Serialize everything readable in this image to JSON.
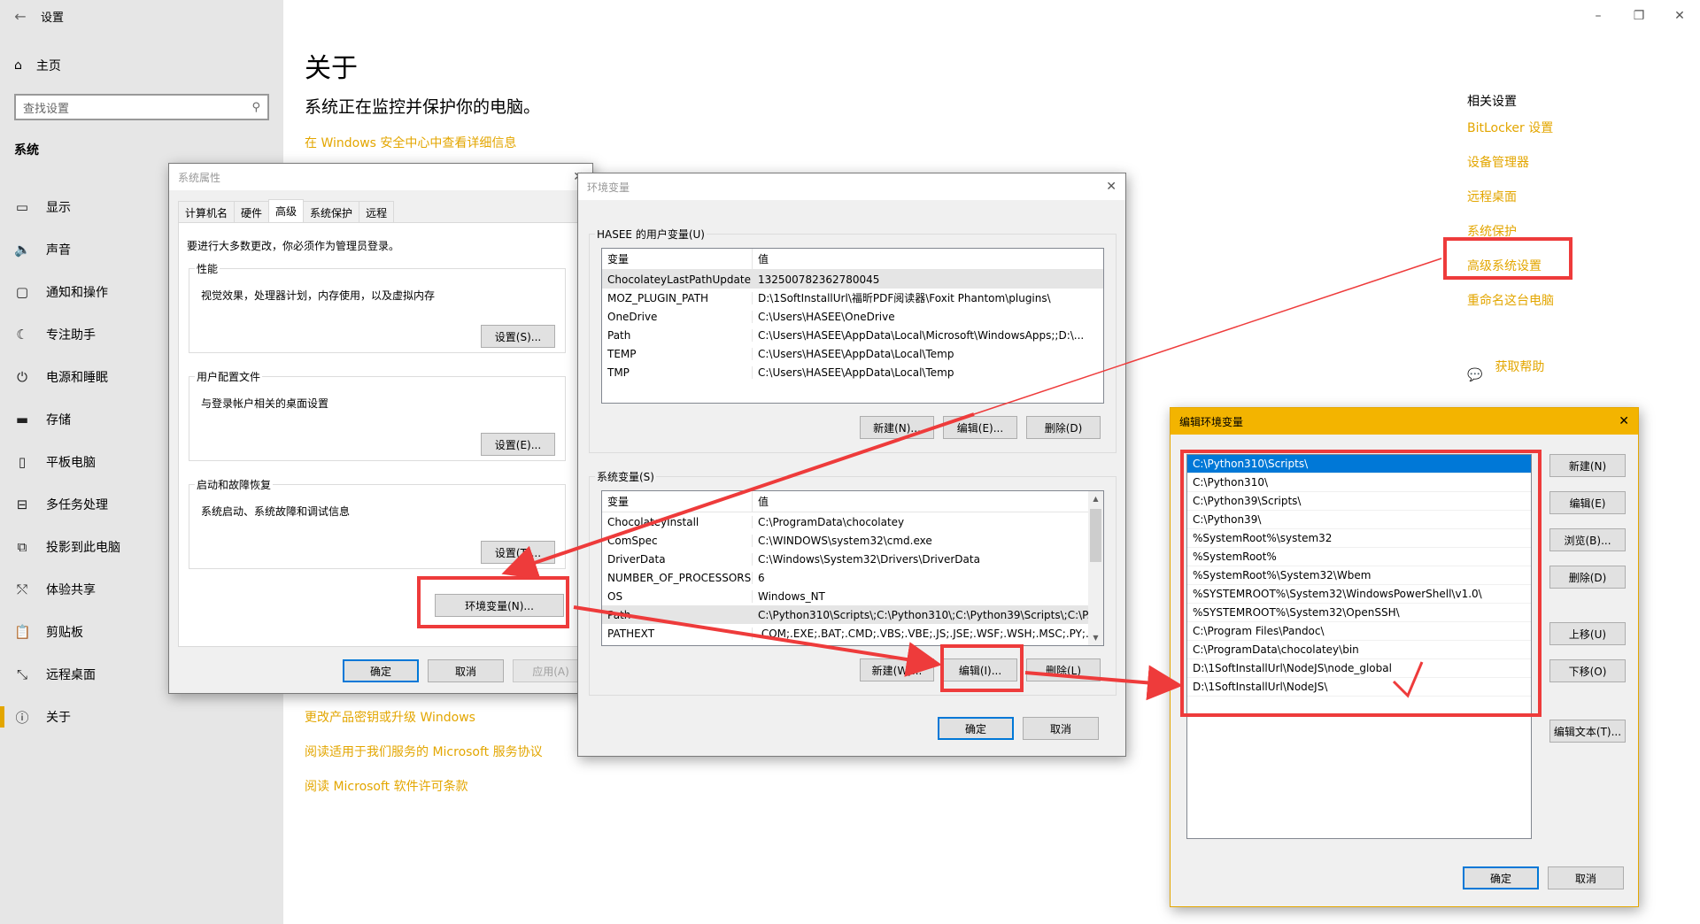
{
  "settings": {
    "window_title": "设置",
    "home_label": "主页",
    "search_placeholder": "查找设置",
    "section_label": "系统",
    "nav": [
      {
        "label": "显示",
        "icon": "monitor-icon"
      },
      {
        "label": "声音",
        "icon": "speaker-icon"
      },
      {
        "label": "通知和操作",
        "icon": "notification-icon"
      },
      {
        "label": "专注助手",
        "icon": "moon-icon"
      },
      {
        "label": "电源和睡眠",
        "icon": "power-icon"
      },
      {
        "label": "存储",
        "icon": "storage-icon"
      },
      {
        "label": "平板电脑",
        "icon": "tablet-icon"
      },
      {
        "label": "多任务处理",
        "icon": "multitask-icon"
      },
      {
        "label": "投影到此电脑",
        "icon": "project-icon"
      },
      {
        "label": "体验共享",
        "icon": "share-icon"
      },
      {
        "label": "剪贴板",
        "icon": "clipboard-icon"
      },
      {
        "label": "远程桌面",
        "icon": "remote-icon"
      },
      {
        "label": "关于",
        "icon": "info-icon",
        "active": true
      }
    ],
    "accent_color": "#e3a600"
  },
  "main": {
    "title": "关于",
    "status": "系统正在监控并保护你的电脑。",
    "security_link": "在 Windows 安全中心中查看详细信息",
    "bottom_links": [
      "更改产品密钥或升级 Windows",
      "阅读适用于我们服务的 Microsoft 服务协议",
      "阅读 Microsoft 软件许可条款"
    ],
    "related": {
      "heading": "相关设置",
      "links": [
        "BitLocker 设置",
        "设备管理器",
        "远程桌面",
        "系统保护",
        "高级系统设置",
        "重命名这台电脑"
      ],
      "help": "获取帮助"
    }
  },
  "sysprop": {
    "title": "系统属性",
    "tabs": [
      "计算机名",
      "硬件",
      "高级",
      "系统保护",
      "远程"
    ],
    "active_tab": 2,
    "note": "要进行大多数更改，你必须作为管理员登录。",
    "performance": {
      "legend": "性能",
      "desc": "视觉效果，处理器计划，内存使用，以及虚拟内存",
      "button": "设置(S)..."
    },
    "profile": {
      "legend": "用户配置文件",
      "desc": "与登录帐户相关的桌面设置",
      "button": "设置(E)..."
    },
    "startup": {
      "legend": "启动和故障恢复",
      "desc": "系统启动、系统故障和调试信息",
      "button": "设置(T)..."
    },
    "env_button": "环境变量(N)...",
    "ok": "确定",
    "cancel": "取消",
    "apply": "应用(A)"
  },
  "envvar": {
    "title": "环境变量",
    "user_group": "HASEE 的用户变量(U)",
    "system_group": "系统变量(S)",
    "col_var": "变量",
    "col_val": "值",
    "user_rows": [
      {
        "name": "ChocolateyLastPathUpdate",
        "value": "132500782362780045"
      },
      {
        "name": "MOZ_PLUGIN_PATH",
        "value": "D:\\1SoftInstallUrl\\福昕PDF阅读器\\Foxit Phantom\\plugins\\"
      },
      {
        "name": "OneDrive",
        "value": "C:\\Users\\HASEE\\OneDrive"
      },
      {
        "name": "Path",
        "value": "C:\\Users\\HASEE\\AppData\\Local\\Microsoft\\WindowsApps;;D:\\..."
      },
      {
        "name": "TEMP",
        "value": "C:\\Users\\HASEE\\AppData\\Local\\Temp"
      },
      {
        "name": "TMP",
        "value": "C:\\Users\\HASEE\\AppData\\Local\\Temp"
      }
    ],
    "system_rows": [
      {
        "name": "ChocolateyInstall",
        "value": "C:\\ProgramData\\chocolatey"
      },
      {
        "name": "ComSpec",
        "value": "C:\\WINDOWS\\system32\\cmd.exe"
      },
      {
        "name": "DriverData",
        "value": "C:\\Windows\\System32\\Drivers\\DriverData"
      },
      {
        "name": "NUMBER_OF_PROCESSORS",
        "value": "6"
      },
      {
        "name": "OS",
        "value": "Windows_NT"
      },
      {
        "name": "Path",
        "value": "C:\\Python310\\Scripts\\;C:\\Python310\\;C:\\Python39\\Scripts\\;C:\\P..."
      },
      {
        "name": "PATHEXT",
        "value": ".COM;.EXE;.BAT;.CMD;.VBS;.VBE;.JS;.JSE;.WSF;.WSH;.MSC;.PY;.P..."
      }
    ],
    "user_new": "新建(N)...",
    "user_edit": "编辑(E)...",
    "user_delete": "删除(D)",
    "sys_new": "新建(W)...",
    "sys_edit": "编辑(I)...",
    "sys_delete": "删除(L)",
    "ok": "确定",
    "cancel": "取消"
  },
  "editenv": {
    "title": "编辑环境变量",
    "items": [
      "C:\\Python310\\Scripts\\",
      "C:\\Python310\\",
      "C:\\Python39\\Scripts\\",
      "C:\\Python39\\",
      "%SystemRoot%\\system32",
      "%SystemRoot%",
      "%SystemRoot%\\System32\\Wbem",
      "%SYSTEMROOT%\\System32\\WindowsPowerShell\\v1.0\\",
      "%SYSTEMROOT%\\System32\\OpenSSH\\",
      "C:\\Program Files\\Pandoc\\",
      "C:\\ProgramData\\chocolatey\\bin",
      "D:\\1SoftInstallUrl\\NodeJS\\node_global",
      "D:\\1SoftInstallUrl\\NodeJS\\"
    ],
    "buttons": [
      "新建(N)",
      "编辑(E)",
      "浏览(B)...",
      "删除(D)",
      "上移(U)",
      "下移(O)",
      "编辑文本(T)..."
    ],
    "ok": "确定",
    "cancel": "取消",
    "title_color": "#f3b400"
  },
  "annotation_color": "#ee3b3b"
}
